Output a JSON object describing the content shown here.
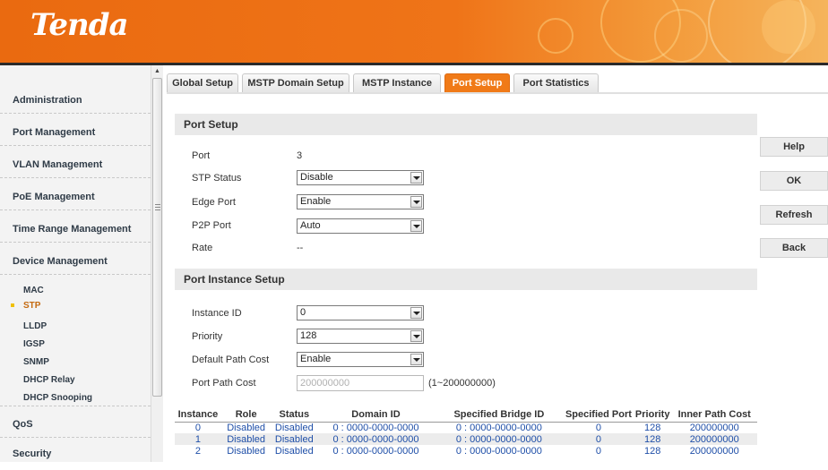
{
  "brand": {
    "logo": "Tenda",
    "accent": "#f07a18"
  },
  "sidebar": {
    "items": [
      {
        "label": "Administration"
      },
      {
        "label": "Port Management"
      },
      {
        "label": "VLAN Management"
      },
      {
        "label": "PoE Management"
      },
      {
        "label": "Time Range Management"
      },
      {
        "label": "Device Management"
      }
    ],
    "sub_items": [
      {
        "label": "MAC",
        "active": false
      },
      {
        "label": "STP",
        "active": true
      },
      {
        "label": "LLDP",
        "active": false
      },
      {
        "label": "IGSP",
        "active": false
      },
      {
        "label": "SNMP",
        "active": false
      },
      {
        "label": "DHCP Relay",
        "active": false
      },
      {
        "label": "DHCP Snooping",
        "active": false
      }
    ],
    "bottom_items": [
      {
        "label": "QoS"
      },
      {
        "label": "Security"
      }
    ]
  },
  "tabs": [
    {
      "label": "Global Setup",
      "active": false
    },
    {
      "label": "MSTP Domain Setup",
      "active": false
    },
    {
      "label": "MSTP Instance",
      "active": false
    },
    {
      "label": "Port Setup",
      "active": true
    },
    {
      "label": "Port Statistics",
      "active": false
    }
  ],
  "port_setup": {
    "title": "Port Setup",
    "port_label": "Port",
    "port_value": "3",
    "stp_status_label": "STP Status",
    "stp_status_value": "Disable",
    "edge_port_label": "Edge Port",
    "edge_port_value": "Enable",
    "p2p_port_label": "P2P Port",
    "p2p_port_value": "Auto",
    "rate_label": "Rate",
    "rate_value": "--"
  },
  "instance_setup": {
    "title": "Port Instance Setup",
    "instance_id_label": "Instance ID",
    "instance_id_value": "0",
    "priority_label": "Priority",
    "priority_value": "128",
    "default_path_cost_label": "Default Path Cost",
    "default_path_cost_value": "Enable",
    "port_path_cost_label": "Port Path Cost",
    "port_path_cost_value": "200000000",
    "port_path_cost_range": "(1~200000000)"
  },
  "buttons": {
    "help": "Help",
    "ok": "OK",
    "refresh": "Refresh",
    "back": "Back"
  },
  "table": {
    "headers": [
      "Instance",
      "Role",
      "Status",
      "Domain ID",
      "Specified Bridge ID",
      "Specified Port",
      "Priority",
      "Inner Path Cost"
    ],
    "rows": [
      [
        "0",
        "Disabled",
        "Disabled",
        "0 : 0000-0000-0000",
        "0 : 0000-0000-0000",
        "0",
        "128",
        "200000000"
      ],
      [
        "1",
        "Disabled",
        "Disabled",
        "0 : 0000-0000-0000",
        "0 : 0000-0000-0000",
        "0",
        "128",
        "200000000"
      ],
      [
        "2",
        "Disabled",
        "Disabled",
        "0 : 0000-0000-0000",
        "0 : 0000-0000-0000",
        "0",
        "128",
        "200000000"
      ]
    ]
  }
}
